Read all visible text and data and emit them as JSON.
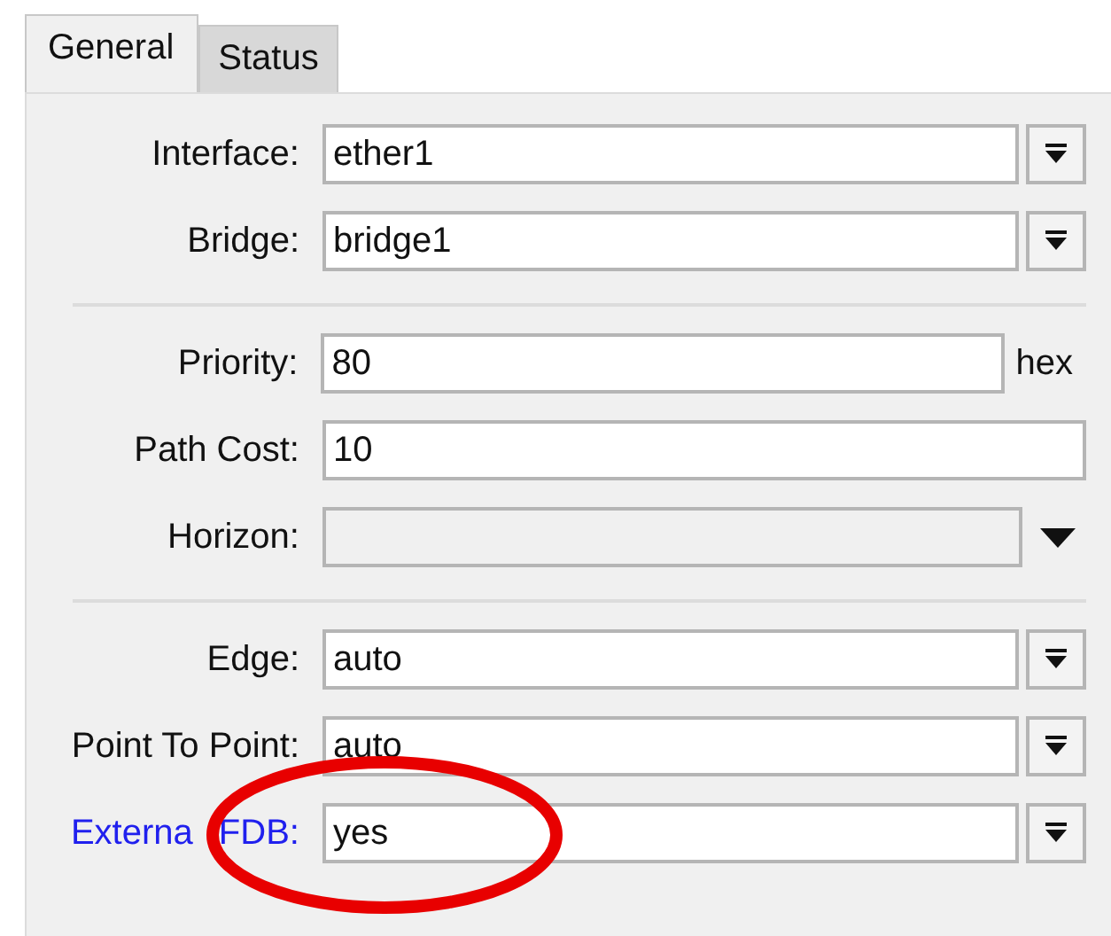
{
  "tabs": [
    {
      "label": "General",
      "selected": true
    },
    {
      "label": "Status",
      "selected": false
    }
  ],
  "groups": [
    [
      {
        "kind": "dropdown",
        "label": "Interface:",
        "value": "ether1",
        "highlighted": false,
        "circled": false
      },
      {
        "kind": "dropdown",
        "label": "Bridge:",
        "value": "bridge1",
        "highlighted": false,
        "circled": false
      }
    ],
    [
      {
        "kind": "unit",
        "label": "Priority:",
        "value": "80",
        "unit": "hex",
        "highlighted": false,
        "circled": false
      },
      {
        "kind": "plain",
        "label": "Path Cost:",
        "value": "10",
        "highlighted": false,
        "circled": false
      },
      {
        "kind": "disabled",
        "label": "Horizon:",
        "highlighted": false,
        "circled": false
      }
    ],
    [
      {
        "kind": "dropdown",
        "label": "Edge:",
        "value": "auto",
        "highlighted": false,
        "circled": false
      },
      {
        "kind": "dropdown",
        "label": "Point To Point:",
        "value": "auto",
        "highlighted": false,
        "circled": false
      },
      {
        "kind": "dropdown",
        "label": "Externa FDB:",
        "value": "yes",
        "highlighted": true,
        "circled": true
      }
    ]
  ]
}
